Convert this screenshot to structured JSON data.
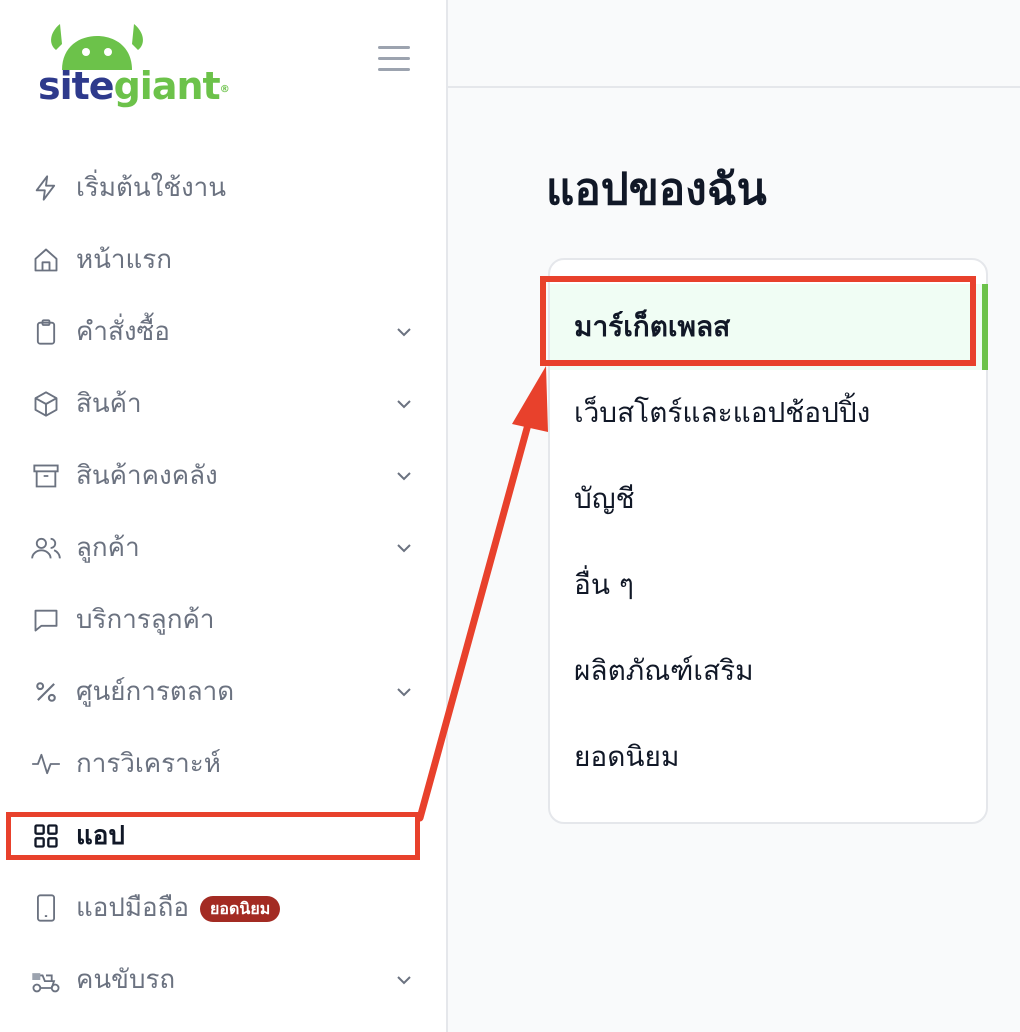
{
  "brand": {
    "part1": "site",
    "part2": "giant",
    "mark": "®",
    "green": "#6cc24a",
    "navy": "#2e3a8c"
  },
  "sidebar": {
    "items": [
      {
        "label": "เริ่มต้นใช้งาน",
        "icon": "lightning-icon",
        "chevron": false
      },
      {
        "label": "หน้าแรก",
        "icon": "home-icon",
        "chevron": false
      },
      {
        "label": "คำสั่งซื้อ",
        "icon": "clipboard-icon",
        "chevron": true
      },
      {
        "label": "สินค้า",
        "icon": "box-icon",
        "chevron": true
      },
      {
        "label": "สินค้าคงคลัง",
        "icon": "archive-icon",
        "chevron": true
      },
      {
        "label": "ลูกค้า",
        "icon": "users-icon",
        "chevron": true
      },
      {
        "label": "บริการลูกค้า",
        "icon": "chat-icon",
        "chevron": false
      },
      {
        "label": "ศูนย์การตลาด",
        "icon": "percent-icon",
        "chevron": true
      },
      {
        "label": "การวิเคราะห์",
        "icon": "activity-icon",
        "chevron": false
      },
      {
        "label": "แอป",
        "icon": "grid-icon",
        "chevron": false,
        "active": true
      },
      {
        "label": "แอปมือถือ",
        "icon": "tablet-icon",
        "chevron": false,
        "badge": "ยอดนิยม"
      },
      {
        "label": "คนขับรถ",
        "icon": "delivery-icon",
        "chevron": true
      }
    ]
  },
  "main": {
    "title": "แอปของฉัน",
    "menu": [
      {
        "label": "มาร์เก็ตเพลส",
        "active": true
      },
      {
        "label": "เว็บสโตร์และแอปช้อปปิ้ง"
      },
      {
        "label": "บัญชี"
      },
      {
        "label": "อื่น ๆ"
      },
      {
        "label": "ผลิตภัณฑ์เสริม"
      },
      {
        "label": "ยอดนิยม"
      }
    ]
  },
  "colors": {
    "highlight": "#e8412c",
    "active_bar": "#6cc24a",
    "badge": "#a32b23"
  }
}
